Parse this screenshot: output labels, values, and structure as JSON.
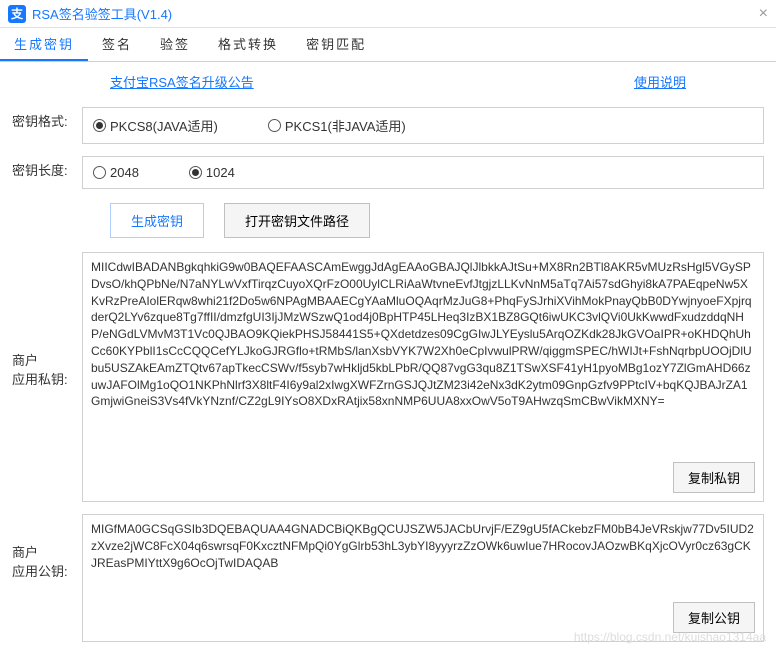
{
  "window": {
    "title": "RSA签名验签工具(V1.4)"
  },
  "tabs": [
    "生成密钥",
    "签名",
    "验签",
    "格式转换",
    "密钥匹配"
  ],
  "activeTab": 0,
  "links": {
    "upgrade": "支付宝RSA签名升级公告",
    "help": "使用说明"
  },
  "format": {
    "label": "密钥格式:",
    "options": [
      "PKCS8(JAVA适用)",
      "PKCS1(非JAVA适用)"
    ],
    "selected": 0
  },
  "length": {
    "label": "密钥长度:",
    "options": [
      "2048",
      "1024"
    ],
    "selected": 1
  },
  "buttons": {
    "generate": "生成密钥",
    "openPath": "打开密钥文件路径",
    "copyPriv": "复制私钥",
    "copyPub": "复制公钥"
  },
  "privateKey": {
    "label1": "商户",
    "label2": "应用私钥:",
    "value": "MIICdwIBADANBgkqhkiG9w0BAQEFAASCAmEwggJdAgEAAoGBAJQlJlbkkAJtSu+MX8Rn2BTl8AKR5vMUzRsHgl5VGySPDvsO/khQPbNe/N7aNYLwVxfTirqzCuyoXQrFzO00UylCLRiAaWtvneEvfJtgjzLLKvNnM5aTq7Ai57sdGhyi8kA7PAEqpeNw5XKvRzPreAIolERqw8whi21f2Do5w6NPAgMBAAECgYAaMluOQAqrMzJuG8+PhqFySJrhiXVihMokPnayQbB0DYwjnyoeFXpjrqderQ2LYv6zque8Tg7ffII/dmzfgUI3IjJMzWSzwQ1od4j0BpHTP45LHeq3IzBX1BZ8GQt6iwUKC3vlQVi0UkKwwdFxudzddqNHP/eNGdLVMvM3T1Vc0QJBAO9KQiekPHSJ58441S5+QXdetdzes09CgGIwJLYEyslu5ArqOZKdk28JkGVOaIPR+oKHDQhUhCc60KYPblI1sCcCQQCefYLJkoGJRGflo+tRMbS/lanXsbVYK7W2Xh0eCpIvwulPRW/qiggmSPEC/hWIJt+FshNqrbpUOOjDlUbu5USZAkEAmZTQtv67apTkecCSWv/f5syb7wHkljd5kbLPbR/QQ87vgG3qu8Z1TSwXSF41yH1pyoMBg1ozY7ZlGmAHD66zuwJAFOlMg1oQO1NKPhNlrf3X8ltF4I6y9al2xIwgXWFZrnGSJQJtZM23i42eNx3dK2ytm09GnpGzfv9PPtcIV+bqKQJBAJrZA1GmjwiGneiS3Vs4fVkYNznf/CZ2gL9IYsO8XDxRAtjix58xnNMP6UUA8xxOwV5oT9AHwzqSmCBwVikMXNY="
  },
  "publicKey": {
    "label1": "商户",
    "label2": "应用公钥:",
    "value": "MIGfMA0GCSqGSIb3DQEBAQUAA4GNADCBiQKBgQCUJSZW5JACbUrvjF/EZ9gU5fACkebzFM0bB4JeVRskjw77Dv5IUD2zXvze2jWC8FcX04q6swrsqF0KxcztNFMpQi0YgGlrb53hL3ybYI8yyyrzZzOWk6uwIue7HRocovJAOzwBKqXjcOVyr0cz63gCKJREasPMIYttX9g6OcOjTwIDAQAB"
  },
  "watermark": "https://blog.csdn.net/kuishao1314aa"
}
